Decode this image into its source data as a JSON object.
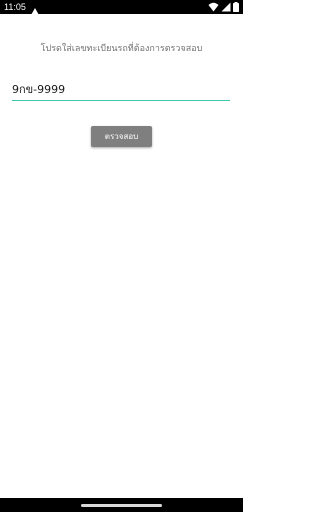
{
  "status_bar": {
    "time": "11:05",
    "icons": [
      "alert-triangle-icon",
      "wifi-icon",
      "cellular-signal-icon",
      "battery-icon"
    ]
  },
  "main": {
    "prompt": "โปรดใส่เลขทะเบียนรถที่ต้องการตรวจสอบ",
    "plate_value": "9กข-9999",
    "check_button_label": "ตรวจสอบ"
  },
  "colors": {
    "accent_underline": "#3cc7ae",
    "button_bg": "#7f7f7f",
    "prompt_text": "#737373"
  }
}
